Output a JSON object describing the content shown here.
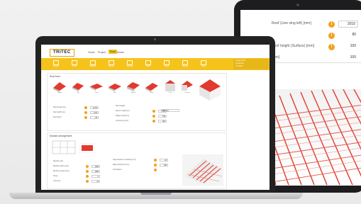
{
  "tablet": {
    "rows": [
      {
        "label": "Roof (Line sing left) [mm]",
        "value": "2010"
      },
      {
        "label": "",
        "value": "80"
      },
      {
        "label": "Roof height (Surface) [mm]",
        "value": "100"
      },
      {
        "label": "[mm]",
        "value": "100"
      }
    ],
    "info_icon": "i"
  },
  "laptop": {
    "logo": "TRITEC",
    "nav": [
      {
        "label": "Home",
        "active": false
      },
      {
        "label": "Project",
        "active": false
      },
      {
        "label": "Roof",
        "active": true
      },
      {
        "label": "Modul",
        "active": false
      }
    ],
    "toolbar": [
      {
        "icon": "project-icon",
        "label": "Project"
      },
      {
        "icon": "roof-icon",
        "label": "Roof"
      },
      {
        "icon": "module-icon",
        "label": "Module"
      },
      {
        "icon": "layout-icon",
        "label": "Layout"
      },
      {
        "icon": "system-icon",
        "label": "System"
      },
      {
        "icon": "static-icon",
        "label": "Static"
      },
      {
        "icon": "parts-icon",
        "label": "Parts"
      },
      {
        "icon": "report-icon",
        "label": "Report"
      },
      {
        "icon": "save-icon",
        "label": "Save"
      }
    ],
    "panel_lines": [
      "Project info",
      "Customer",
      "Location"
    ],
    "roof_section": {
      "title": "Roof form",
      "roofs": [
        "Gable",
        "Hip",
        "Pent",
        "Flat",
        "Gable 2",
        "Shed",
        "Tent",
        "Custom"
      ],
      "fields": [
        {
          "label": "Roof length [m]",
          "value": "12.00"
        },
        {
          "label": "Roof width [m]",
          "value": "8.00"
        },
        {
          "label": "Roof pitch",
          "value": "30"
        }
      ],
      "fields2": [
        {
          "label": "Roof height",
          "value": ""
        },
        {
          "label": "Eaves height [m]",
          "value": "3.50"
        },
        {
          "label": "Ridge height [m]",
          "value": "7.50"
        },
        {
          "label": "Overhang [mm]",
          "value": "300"
        }
      ],
      "select_value": "Tile roof"
    },
    "module_section": {
      "title": "Module arrangement",
      "fields": [
        {
          "label": "Module type",
          "value": ""
        },
        {
          "label": "Module width [mm]",
          "value": "1000"
        },
        {
          "label": "Module length [mm]",
          "value": "1650"
        },
        {
          "label": "Rows",
          "value": "4"
        },
        {
          "label": "Columns",
          "value": "10"
        }
      ],
      "fields2": [
        {
          "label": "Gap between modules [mm]",
          "value": "20"
        },
        {
          "label": "Edge distance [mm]",
          "value": "300"
        },
        {
          "label": "Orientation",
          "value": ""
        }
      ]
    }
  },
  "colors": {
    "accent_yellow": "#f6c31c",
    "accent_orange": "#f3a11b",
    "roof_red": "#e23a2e"
  }
}
